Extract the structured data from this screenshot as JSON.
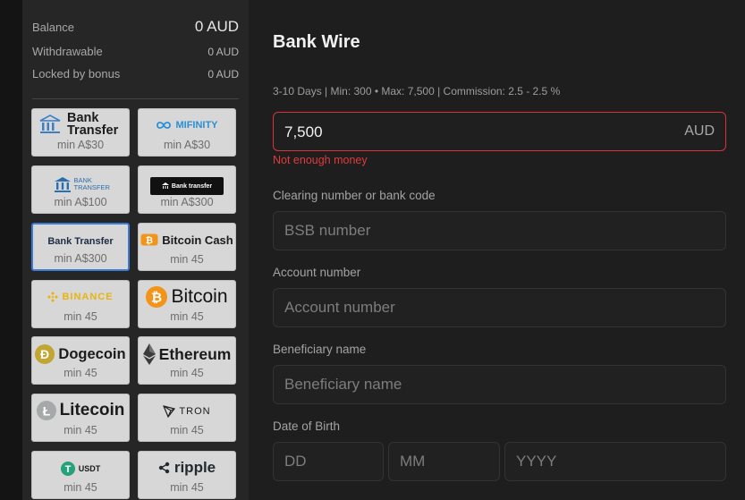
{
  "balance": {
    "balance_label": "Balance",
    "balance_value": "0 AUD",
    "withdrawable_label": "Withdrawable",
    "withdrawable_value": "0 AUD",
    "locked_label": "Locked by bonus",
    "locked_value": "0 AUD"
  },
  "methods": [
    {
      "logo": "Bank Transfer",
      "min": "min A$30"
    },
    {
      "logo": "MIFINITY",
      "min": "min A$30"
    },
    {
      "logo": "BANK TRANSFER",
      "min": "min A$100"
    },
    {
      "logo": "Bank transfer",
      "min": "min A$300"
    },
    {
      "logo": "Bank Transfer",
      "min": "min A$300",
      "selected": true
    },
    {
      "logo": "Bitcoin Cash",
      "min": "min 45"
    },
    {
      "logo": "BINANCE",
      "min": "min 45"
    },
    {
      "logo": "Bitcoin",
      "min": "min 45"
    },
    {
      "logo": "Dogecoin",
      "min": "min 45"
    },
    {
      "logo": "Ethereum",
      "min": "min 45"
    },
    {
      "logo": "Litecoin",
      "min": "min 45"
    },
    {
      "logo": "TRON",
      "min": "min 45"
    },
    {
      "logo": "USDT",
      "min": "min 45"
    },
    {
      "logo": "ripple",
      "min": "min 45"
    }
  ],
  "form": {
    "title": "Bank Wire",
    "info": "3-10 Days | Min: 300 • Max: 7,500 | Commission: 2.5 - 2.5 %",
    "amount": "7,500",
    "currency": "AUD",
    "error": "Not enough money",
    "bank_code_label": "Clearing number or bank code",
    "bank_code_placeholder": "BSB number",
    "account_label": "Account number",
    "account_placeholder": "Account number",
    "beneficiary_label": "Beneficiary name",
    "beneficiary_placeholder": "Beneficiary name",
    "dob_label": "Date of Birth",
    "dob_day_placeholder": "DD",
    "dob_month_placeholder": "MM",
    "dob_year_placeholder": "YYYY"
  },
  "colors": {
    "error": "#e23a3a",
    "selected_border": "#3a7bd5",
    "mifinity": "#2a8fd6",
    "bitcoin": "#f2941a",
    "dogecoin": "#c2a633",
    "tether": "#26a17b",
    "ripple": "#23292f"
  }
}
